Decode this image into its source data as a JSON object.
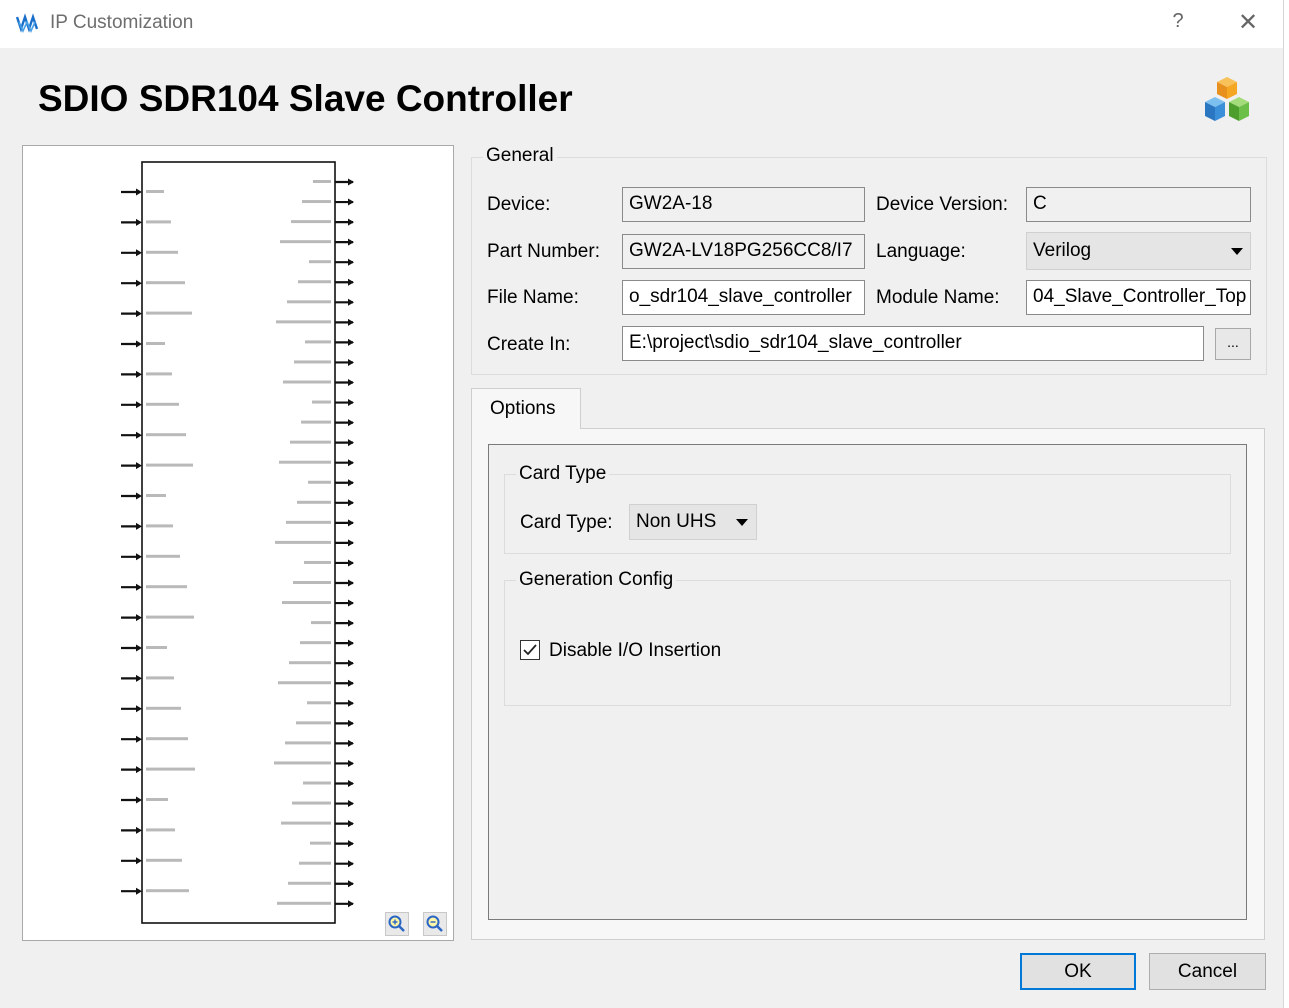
{
  "window": {
    "title": "IP Customization",
    "help_symbol": "?",
    "close_symbol": "✕"
  },
  "heading": "SDIO SDR104 Slave Controller",
  "general": {
    "group_title": "General",
    "device_label": "Device:",
    "device_value": "GW2A-18",
    "device_version_label": "Device Version:",
    "device_version_value": "C",
    "part_number_label": "Part Number:",
    "part_number_value": "GW2A-LV18PG256CC8/I7",
    "language_label": "Language:",
    "language_value": "Verilog",
    "file_name_label": "File Name:",
    "file_name_value": "o_sdr104_slave_controller",
    "module_name_label": "Module Name:",
    "module_name_value": "04_Slave_Controller_Top",
    "create_in_label": "Create In:",
    "create_in_value": "E:\\project\\sdio_sdr104_slave_controller",
    "browse_label": "..."
  },
  "tabs": [
    {
      "label": "Options"
    }
  ],
  "options": {
    "card_type_group": "Card Type",
    "card_type_label": "Card Type:",
    "card_type_value": "Non UHS",
    "generation_group": "Generation Config",
    "disable_io_label": "Disable I/O Insertion",
    "disable_io_checked": true
  },
  "buttons": {
    "ok": "OK",
    "cancel": "Cancel"
  },
  "preview": {
    "left_ports": 24,
    "right_ports": 37,
    "zoom_in_icon": "zoom-in-icon",
    "zoom_out_icon": "zoom-out-icon"
  },
  "colors": {
    "accent": "#0078d7",
    "window_bg": "#f0f0f0",
    "cube_orange": "#f5a623",
    "cube_blue": "#3b8fd9",
    "cube_green": "#6cc04a"
  }
}
